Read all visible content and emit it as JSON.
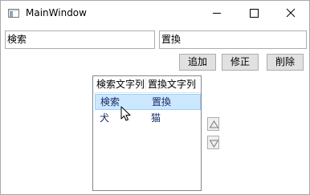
{
  "window": {
    "title": "MainWindow",
    "controls": [
      "minimize-icon",
      "maximize-icon",
      "close-icon"
    ]
  },
  "inputs": {
    "search_value": "検索",
    "replace_value": "置換"
  },
  "buttons": {
    "add": "追加",
    "modify": "修正",
    "delete": "削除"
  },
  "list": {
    "columns": [
      "検索文字列",
      "置換文字列"
    ],
    "rows": [
      [
        "検索",
        "置換"
      ],
      [
        "犬",
        "猫"
      ]
    ],
    "selected_row": 0
  },
  "side_buttons": {
    "up_icon": "triangle-up-icon",
    "down_icon": "triangle-down-icon"
  },
  "colors": {
    "selection_bg": "#cce8ff",
    "selection_border": "#99d1ff",
    "button_bg": "#e1e1e1"
  }
}
